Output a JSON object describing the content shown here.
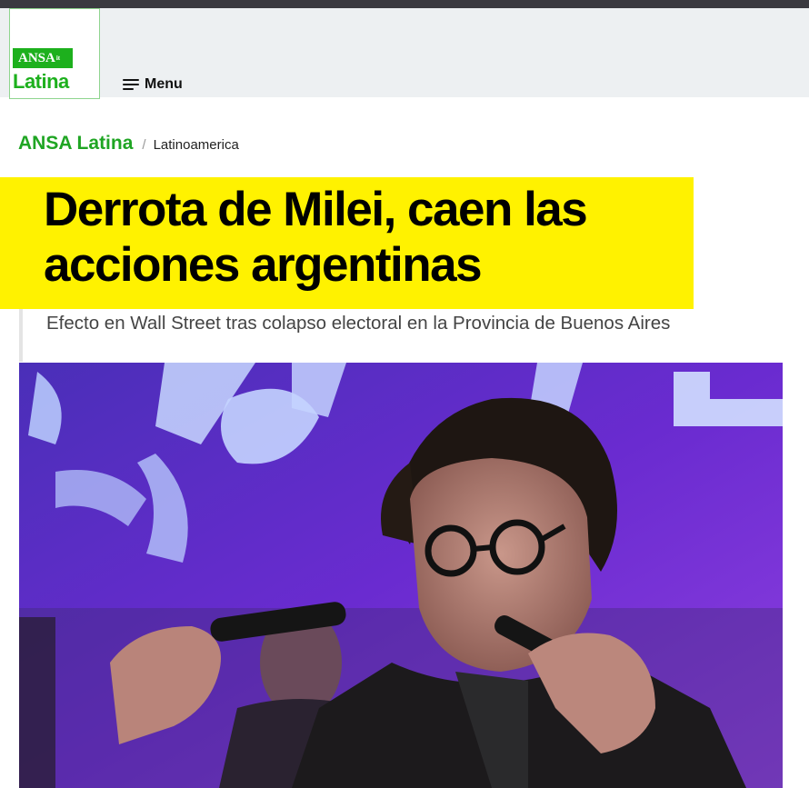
{
  "header": {
    "logo": {
      "brand": "ANSA",
      "sup": "it",
      "sub": "Latina"
    },
    "menu_label": "Menu"
  },
  "breadcrumb": {
    "home": "ANSA Latina",
    "separator": "/",
    "category": "Latinoamerica"
  },
  "article": {
    "title": "Derrota de Milei, caen las acciones argentinas",
    "subtitle": "Efecto en Wall Street tras colapso electoral en la Provincia de Buenos Aires"
  },
  "colors": {
    "brand_green": "#1db01d",
    "highlight_yellow": "#fff200",
    "header_bg": "#edf0f2"
  }
}
